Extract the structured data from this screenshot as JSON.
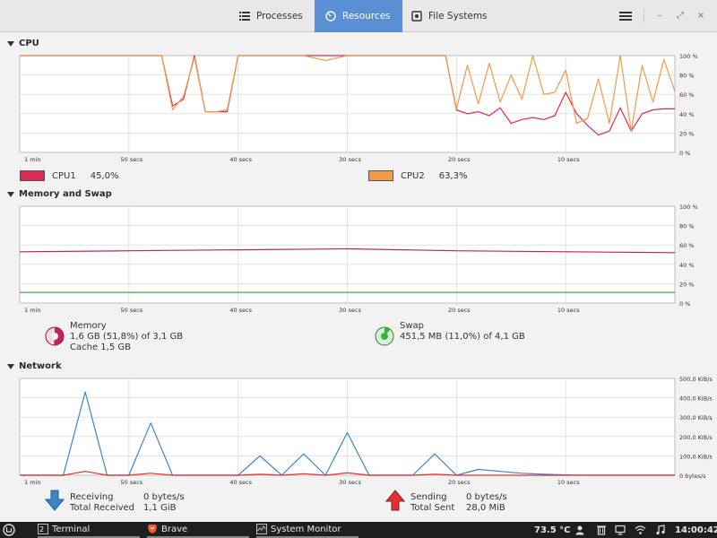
{
  "tabs": [
    {
      "label": "Processes",
      "icon": "list-icon"
    },
    {
      "label": "Resources",
      "icon": "gauge-icon",
      "active": true
    },
    {
      "label": "File Systems",
      "icon": "disk-icon"
    }
  ],
  "window_controls": {
    "minimize": "–",
    "maximize": "⤢",
    "close": "×"
  },
  "cpu": {
    "title": "CPU",
    "y_ticks": [
      "100 %",
      "80 %",
      "60 %",
      "40 %",
      "20 %",
      "0 %"
    ],
    "x_ticks": [
      "1 min",
      "50 secs",
      "40 secs",
      "30 secs",
      "20 secs",
      "10 secs"
    ],
    "legend": [
      {
        "name": "CPU1",
        "value": "45,0%",
        "color": "#dc2a55"
      },
      {
        "name": "CPU2",
        "value": "63,3%",
        "color": "#f39a4a"
      }
    ]
  },
  "memory": {
    "title": "Memory and Swap",
    "y_ticks": [
      "100 %",
      "80 %",
      "60 %",
      "40 %",
      "20 %",
      "0 %"
    ],
    "x_ticks": [
      "1 min",
      "50 secs",
      "40 secs",
      "30 secs",
      "20 secs",
      "10 secs"
    ],
    "mem_label": "Memory",
    "mem_usage": "1,6 GB (51,8%) of 3,1 GB",
    "mem_cache": "Cache 1,5 GB",
    "swap_label": "Swap",
    "swap_usage": "451,5 MB (11,0%) of 4,1 GB",
    "mem_color": "#c0225a",
    "swap_color": "#3fae3f"
  },
  "network": {
    "title": "Network",
    "y_ticks": [
      "500,0 KiB/s",
      "400,0 KiB/s",
      "300,0 KiB/s",
      "200,0 KiB/s",
      "100,0 KiB/s",
      "0 bytes/s"
    ],
    "x_ticks": [
      "1 min",
      "50 secs",
      "40 secs",
      "30 secs",
      "20 secs",
      "10 secs"
    ],
    "receiving_label": "Receiving",
    "receiving_value": "0 bytes/s",
    "total_received_label": "Total Received",
    "total_received_value": "1,1 GiB",
    "sending_label": "Sending",
    "sending_value": "0 bytes/s",
    "total_sent_label": "Total Sent",
    "total_sent_value": "28,0 MiB",
    "recv_color": "#3a86c8",
    "send_color": "#e03030"
  },
  "chart_data": [
    {
      "type": "line",
      "title": "CPU",
      "x": [
        60,
        58,
        56,
        54,
        52,
        50,
        48,
        47,
        46,
        45,
        44,
        43,
        42,
        41,
        40,
        38,
        36,
        34,
        32,
        30,
        28,
        26,
        24,
        22,
        21,
        20,
        19,
        18,
        17,
        16,
        15,
        14,
        13,
        12,
        11,
        10,
        9,
        8,
        7,
        6,
        5,
        4,
        3,
        2,
        1,
        0
      ],
      "series": [
        {
          "name": "CPU1",
          "values": [
            100,
            100,
            100,
            100,
            100,
            100,
            100,
            100,
            48,
            55,
            100,
            42,
            42,
            42,
            100,
            100,
            100,
            100,
            100,
            100,
            100,
            100,
            100,
            100,
            100,
            44,
            40,
            42,
            38,
            46,
            30,
            34,
            36,
            34,
            38,
            62,
            40,
            28,
            18,
            22,
            46,
            22,
            40,
            44,
            45,
            45
          ]
        },
        {
          "name": "CPU2",
          "values": [
            100,
            100,
            100,
            100,
            100,
            100,
            100,
            100,
            44,
            58,
            98,
            42,
            42,
            44,
            100,
            100,
            100,
            100,
            95,
            100,
            100,
            100,
            100,
            100,
            100,
            45,
            90,
            50,
            92,
            52,
            80,
            55,
            100,
            60,
            62,
            85,
            30,
            35,
            76,
            30,
            100,
            22,
            90,
            52,
            96,
            63
          ]
        }
      ],
      "ylim": [
        0,
        100
      ]
    },
    {
      "type": "line",
      "title": "Memory and Swap",
      "x": [
        60,
        50,
        40,
        30,
        20,
        10,
        0
      ],
      "series": [
        {
          "name": "Memory",
          "values": [
            53,
            54,
            55,
            56,
            54,
            53,
            52
          ]
        },
        {
          "name": "Swap",
          "values": [
            11,
            11,
            11,
            11,
            11,
            11,
            11
          ]
        }
      ],
      "ylim": [
        0,
        100
      ]
    },
    {
      "type": "line",
      "title": "Network",
      "x": [
        60,
        58,
        56,
        54,
        52,
        50,
        48,
        46,
        44,
        42,
        40,
        38,
        36,
        34,
        32,
        30,
        28,
        26,
        24,
        22,
        20,
        18,
        16,
        14,
        12,
        10,
        8,
        6,
        4,
        2,
        0
      ],
      "series": [
        {
          "name": "Receiving",
          "values": [
            0,
            0,
            0,
            430,
            0,
            0,
            270,
            0,
            0,
            0,
            0,
            100,
            0,
            110,
            0,
            220,
            0,
            0,
            0,
            110,
            0,
            30,
            20,
            10,
            5,
            2,
            0,
            0,
            0,
            0,
            0
          ]
        },
        {
          "name": "Sending",
          "values": [
            0,
            0,
            0,
            20,
            0,
            0,
            10,
            0,
            0,
            0,
            0,
            5,
            0,
            8,
            0,
            12,
            0,
            0,
            0,
            5,
            0,
            0,
            0,
            0,
            0,
            0,
            0,
            0,
            0,
            0,
            0
          ]
        }
      ],
      "ylim": [
        0,
        500
      ]
    }
  ],
  "taskbar": {
    "terminal_label": "Terminal",
    "brave_label": "Brave",
    "sysmon_label": "System Monitor",
    "temperature": "73.5 °C",
    "clock": "14:00:42"
  }
}
